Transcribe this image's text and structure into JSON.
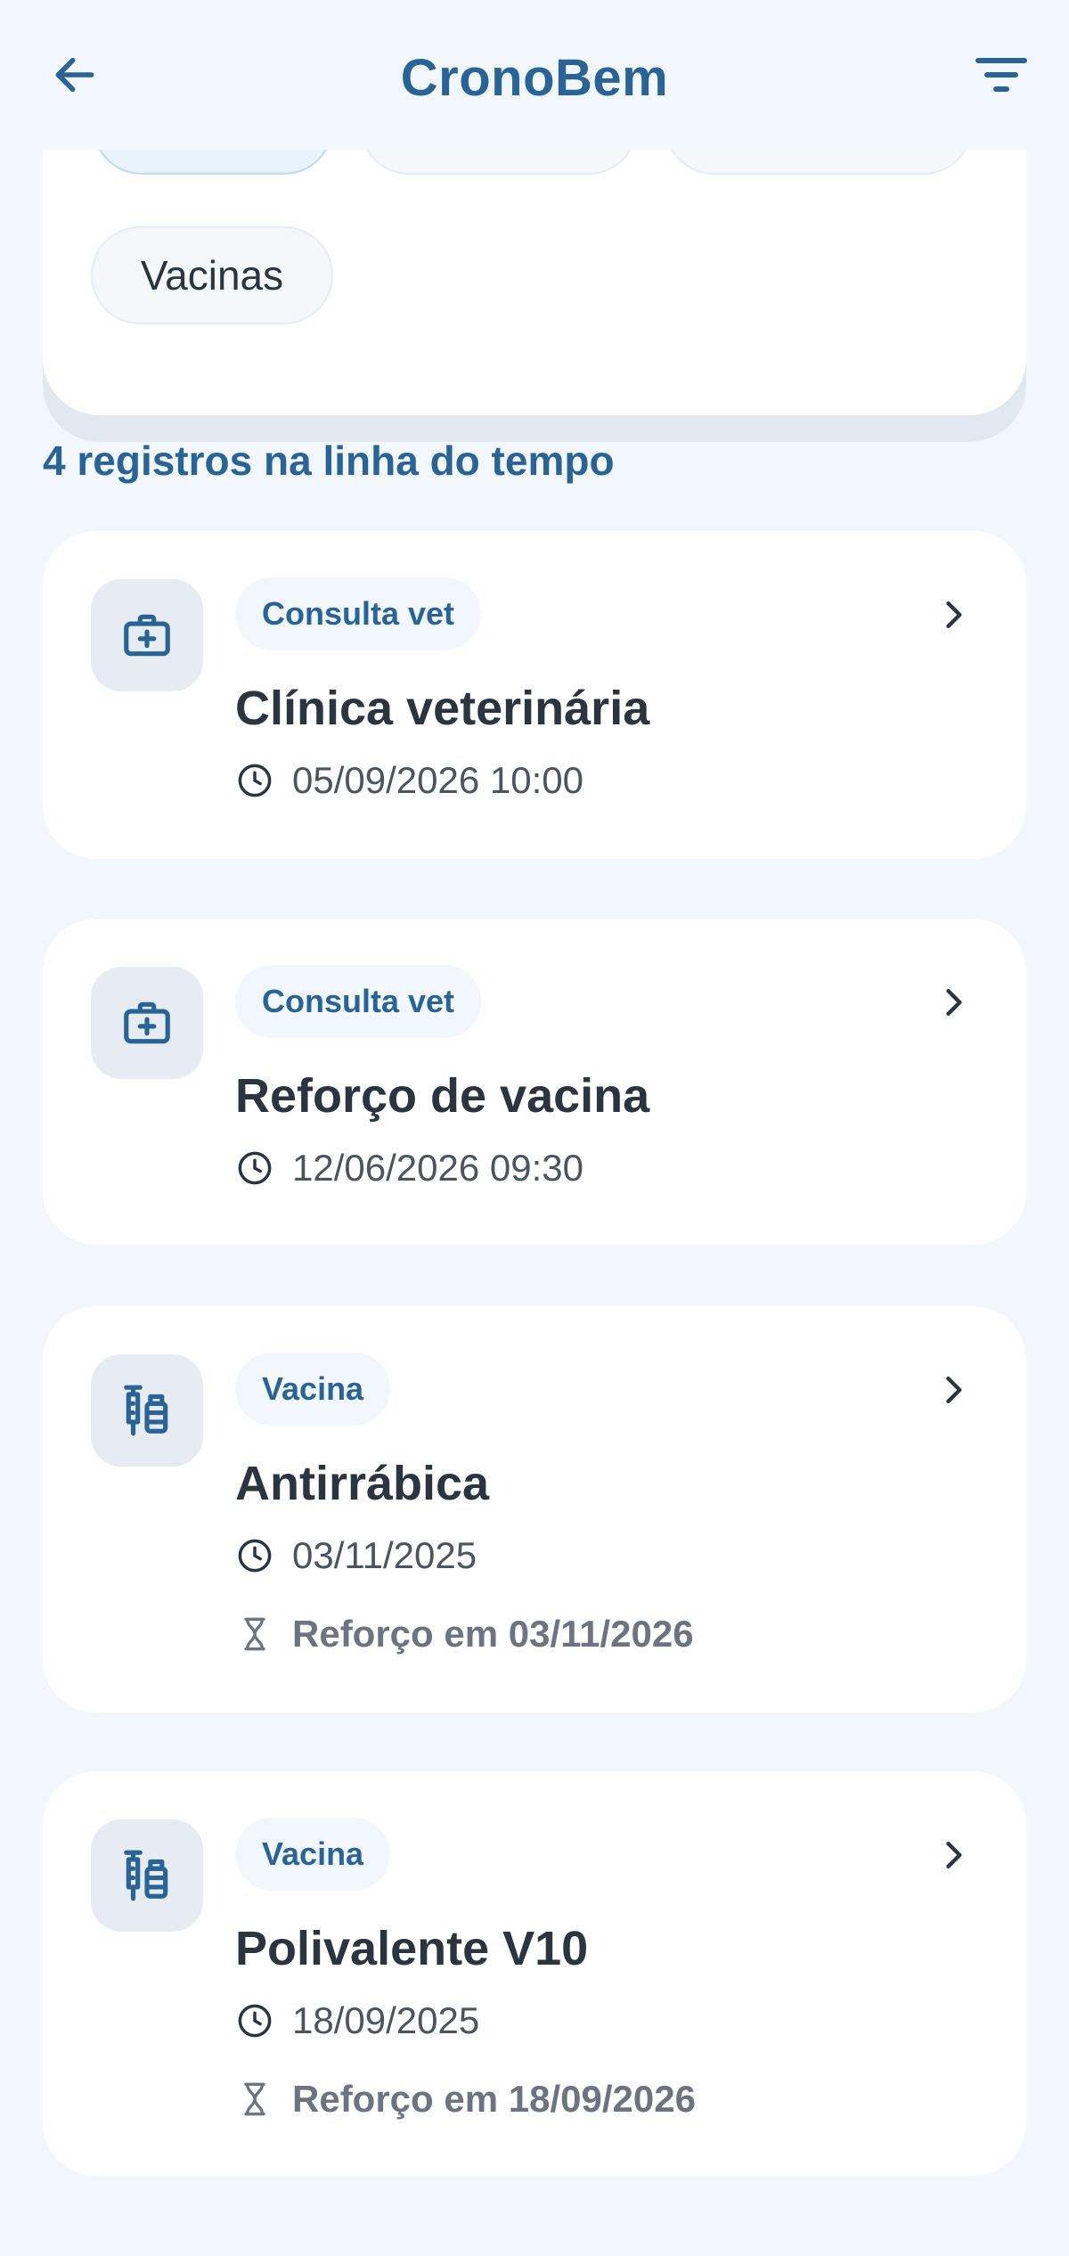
{
  "header": {
    "title": "CronoBem",
    "back_icon": "arrow-left-icon",
    "filter_icon": "filter-icon"
  },
  "filters": {
    "chips": [
      {
        "label": "",
        "active": true
      },
      {
        "label": "",
        "active": false
      },
      {
        "label": "",
        "active": false
      },
      {
        "label": "Vacinas",
        "active": false
      }
    ]
  },
  "timeline": {
    "count_label": "4 registros na linha do tempo",
    "records": [
      {
        "badge": "Consulta vet",
        "title": "Clínica veterinária",
        "datetime": "05/09/2026 10:00",
        "icon": "medical-kit-icon"
      },
      {
        "badge": "Consulta vet",
        "title": "Reforço de vacina",
        "datetime": "12/06/2026 09:30",
        "icon": "medical-kit-icon"
      },
      {
        "badge": "Vacina",
        "title": "Antirrábica",
        "datetime": "03/11/2025",
        "booster": "Reforço em 03/11/2026",
        "icon": "vaccine-icon"
      },
      {
        "badge": "Vacina",
        "title": "Polivalente V10",
        "datetime": "18/09/2025",
        "booster": "Reforço em 18/09/2026",
        "icon": "vaccine-icon"
      }
    ]
  },
  "colors": {
    "accent": "#2a6496",
    "background": "#f1f7fd",
    "card": "#ffffff",
    "text": "#2a3540"
  }
}
